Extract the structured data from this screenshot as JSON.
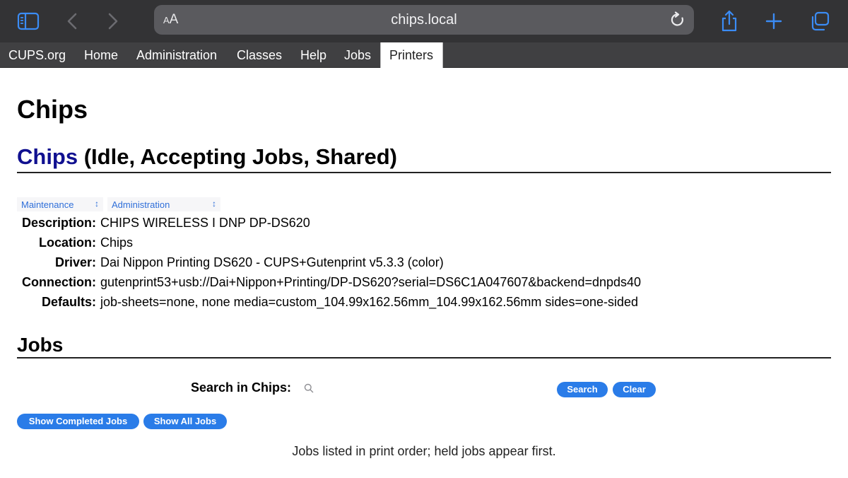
{
  "browser": {
    "url": "chips.local",
    "aa_label": "AA",
    "icons": [
      "sidebar-icon",
      "back-icon",
      "forward-icon",
      "reload-icon",
      "share-icon",
      "new-tab-icon",
      "tabs-overview-icon"
    ]
  },
  "nav": {
    "tabs": [
      {
        "label": "CUPS.org"
      },
      {
        "label": "Home"
      },
      {
        "label": "Administration"
      },
      {
        "label": "Classes"
      },
      {
        "label": "Help"
      },
      {
        "label": "Jobs"
      },
      {
        "label": "Printers",
        "active": true
      }
    ]
  },
  "page": {
    "title": "Chips",
    "printer_name": "Chips",
    "printer_status": " (Idle, Accepting Jobs, Shared)"
  },
  "actions": {
    "maintenance": "Maintenance",
    "administration": "Administration"
  },
  "details": [
    {
      "label": "Description:",
      "value": "CHIPS WIRELESS I DNP DP-DS620"
    },
    {
      "label": "Location:",
      "value": "Chips"
    },
    {
      "label": "Driver:",
      "value": "Dai Nippon Printing DS620 - CUPS+Gutenprint v5.3.3 (color)"
    },
    {
      "label": "Connection:",
      "value": "gutenprint53+usb://Dai+Nippon+Printing/DP-DS620?serial=DS6C1A047607&backend=dnpds40"
    },
    {
      "label": "Defaults:",
      "value": "job-sheets=none, none media=custom_104.99x162.56mm_104.99x162.56mm sides=one-sided"
    }
  ],
  "jobs": {
    "heading": "Jobs",
    "search_label": "Search in Chips:",
    "search_value": "",
    "search_button": "Search",
    "clear_button": "Clear",
    "show_completed_button": "Show Completed Jobs",
    "show_all_button": "Show All Jobs",
    "note": "Jobs listed in print order; held jobs appear first."
  },
  "colors": {
    "toolbar_bg": "#333335",
    "nav_bg": "#404042",
    "accent": "#2a7ce8",
    "printer_link": "#101090"
  }
}
